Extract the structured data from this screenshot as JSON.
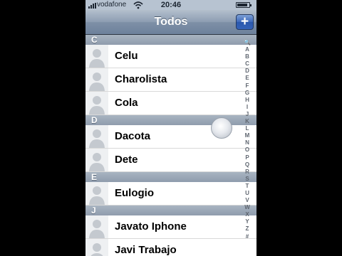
{
  "status_bar": {
    "carrier": "vodafone",
    "time": "20:46",
    "signal_bars": 4,
    "battery_level": 0.85,
    "icons": [
      "signal-icon",
      "wifi-icon",
      "battery-icon"
    ]
  },
  "nav_bar": {
    "title": "Todos",
    "add_button_label": "+"
  },
  "sections": [
    {
      "letter": "C",
      "contacts": [
        "Celu",
        "Charolista",
        "Cola"
      ]
    },
    {
      "letter": "D",
      "contacts": [
        "Dacota",
        "Dete"
      ]
    },
    {
      "letter": "E",
      "contacts": [
        "Eulogio"
      ]
    },
    {
      "letter": "J",
      "contacts": [
        "Javato Iphone",
        "Javi Trabajo"
      ]
    }
  ],
  "index": [
    "🔍",
    "A",
    "B",
    "C",
    "D",
    "E",
    "F",
    "G",
    "H",
    "I",
    "J",
    "K",
    "L",
    "M",
    "N",
    "O",
    "P",
    "Q",
    "R",
    "S",
    "T",
    "U",
    "V",
    "W",
    "X",
    "Y",
    "Z",
    "#"
  ],
  "colors": {
    "nav_accent": "#6d819b",
    "add_button": "#2a57ad",
    "section_header": "#8f9cad"
  }
}
